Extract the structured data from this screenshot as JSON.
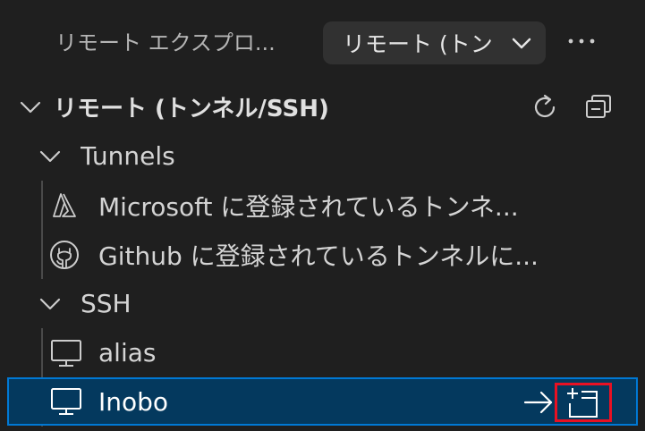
{
  "header": {
    "title": "リモート エクスプロ...",
    "dropdown_label": "リモート (トン",
    "more_icon": "ellipsis-icon"
  },
  "section": {
    "label": "リモート (トンネル/SSH)",
    "actions": [
      "refresh-icon",
      "collapse-all-icon"
    ]
  },
  "tree": {
    "tunnels": {
      "label": "Tunnels",
      "items": [
        {
          "label": "Microsoft に登録されているトンネ...",
          "icon": "microsoft-azure-icon"
        },
        {
          "label": "Github に登録されているトンネルに...",
          "icon": "github-icon"
        }
      ]
    },
    "ssh": {
      "label": "SSH",
      "items": [
        {
          "label": "alias",
          "icon": "monitor-icon"
        },
        {
          "label": "Inobo",
          "icon": "monitor-icon",
          "selected": true
        }
      ]
    }
  },
  "row_actions": [
    "connect-arrow-icon",
    "open-new-window-icon"
  ],
  "colors": {
    "background": "#1f1f1f",
    "selection_bg": "#04395e",
    "selection_border": "#0078d4",
    "highlight_box": "#e81123"
  }
}
